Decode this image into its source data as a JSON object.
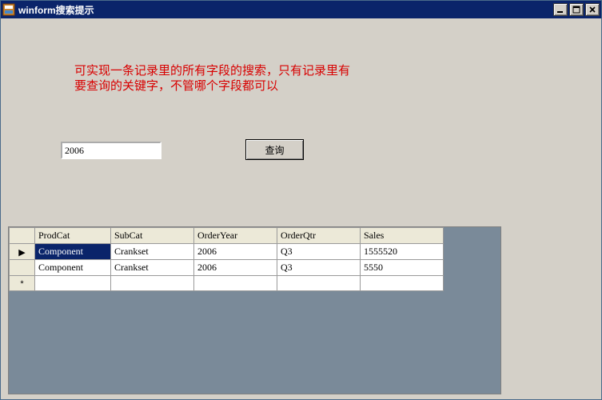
{
  "window": {
    "title": "winform搜索提示"
  },
  "description": {
    "line1": "可实现一条记录里的所有字段的搜索，只有记录里有",
    "line2": "要查询的关键字，不管哪个字段都可以"
  },
  "search": {
    "value": "2006",
    "button_label": "查询"
  },
  "grid": {
    "columns": [
      "ProdCat",
      "SubCat",
      "OrderYear",
      "OrderQtr",
      "Sales"
    ],
    "rows": [
      {
        "indicator": "▶",
        "cells": [
          "Component",
          "Crankset",
          "2006",
          "Q3",
          "1555520"
        ],
        "selected_col": 0
      },
      {
        "indicator": "",
        "cells": [
          "Component",
          "Crankset",
          "2006",
          "Q3",
          "5550"
        ],
        "selected_col": -1
      }
    ],
    "new_row_indicator": "*"
  }
}
